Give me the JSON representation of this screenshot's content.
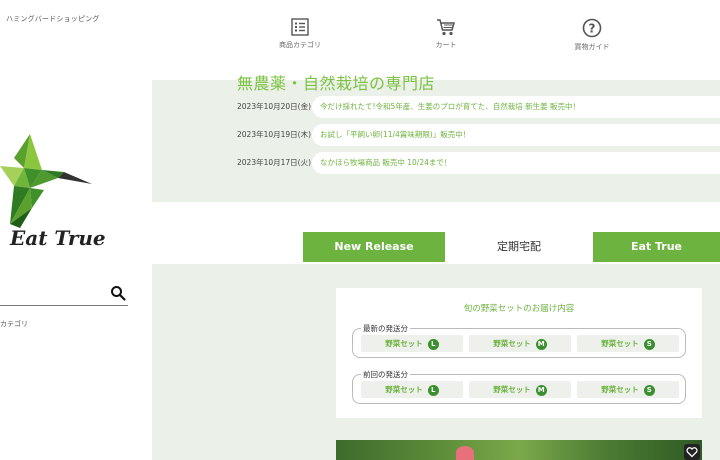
{
  "sidebar": {
    "site_name": "ハミングバードショッピング",
    "logo_text": "Eat True",
    "search_placeholder": "",
    "category_label": "カテゴリ"
  },
  "topnav": {
    "items": [
      {
        "label": "商品カテゴリ",
        "icon": "list-icon"
      },
      {
        "label": "カート",
        "icon": "cart-icon"
      },
      {
        "label": "買物ガイド",
        "icon": "help-icon"
      }
    ]
  },
  "headline": "無農薬・自然栽培の専門店",
  "news": [
    {
      "date": "2023年10月20日(金)",
      "text": "今だけ採れたて!令和5年産、生姜のプロが育てた、自然栽培 新生姜 販売中！"
    },
    {
      "date": "2023年10月19日(木)",
      "text": "お試し「平飼い卵(11/4賞味期限)」販売中！"
    },
    {
      "date": "2023年10月17日(火)",
      "text": "なかほら牧場商品 販売中 10/24まで！"
    }
  ],
  "tabs": [
    {
      "label": "New Release",
      "active": false
    },
    {
      "label": "定期宅配",
      "active": true
    },
    {
      "label": "Eat True",
      "active": false
    }
  ],
  "card": {
    "title": "旬の野菜セットのお届け内容",
    "groups": [
      {
        "label": "最新の発送分",
        "items": [
          {
            "label": "野菜セット",
            "size": "L"
          },
          {
            "label": "野菜セット",
            "size": "M"
          },
          {
            "label": "野菜セット",
            "size": "S"
          }
        ]
      },
      {
        "label": "前回の発送分",
        "items": [
          {
            "label": "野菜セット",
            "size": "L"
          },
          {
            "label": "野菜セット",
            "size": "M"
          },
          {
            "label": "野菜セット",
            "size": "S"
          }
        ]
      }
    ]
  },
  "colors": {
    "brand_green": "#6db33f",
    "headline_green": "#7cc242",
    "badge_green": "#3a8f2f",
    "main_bg": "#ebf0e9"
  }
}
